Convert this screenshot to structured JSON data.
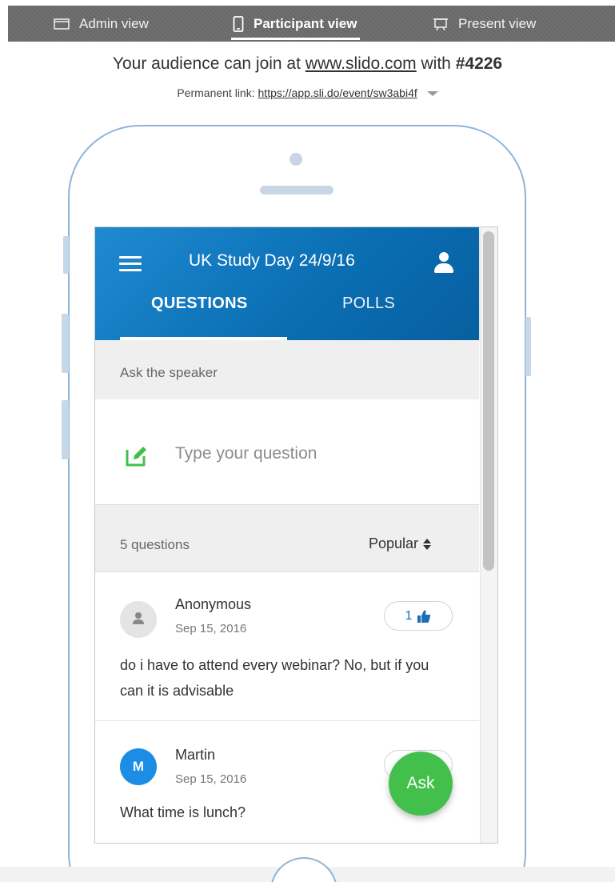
{
  "toolbar": {
    "tabs": [
      {
        "label": "Admin view",
        "icon": "window-icon",
        "active": false
      },
      {
        "label": "Participant view",
        "icon": "mobile-phone-icon",
        "active": true
      },
      {
        "label": "Present view",
        "icon": "projector-screen-icon",
        "active": false
      }
    ]
  },
  "join": {
    "prefix": "Your audience can join at",
    "url": "www.slido.com",
    "middle": "with",
    "code": "#4226",
    "permanent_label": "Permanent link:",
    "permanent_link": "https://app.sli.do/event/sw3abi4f"
  },
  "app": {
    "event_title": "UK Study Day 24/9/16",
    "tabs": [
      {
        "label": "QUESTIONS",
        "active": true
      },
      {
        "label": "POLLS",
        "active": false
      }
    ],
    "ask_label": "Ask the speaker",
    "question_placeholder": "Type your question",
    "question_count": "5 questions",
    "sort_value": "Popular",
    "questions": [
      {
        "author": "Anonymous",
        "avatar": "",
        "date": "Sep 15, 2016",
        "likes": "1",
        "text": "do i have to attend every webinar? No, but if you can it is advisable"
      },
      {
        "author": "Martin",
        "avatar": "M",
        "date": "Sep 15, 2016",
        "likes": "",
        "text": "What time is lunch?"
      }
    ],
    "ask_button": "Ask"
  },
  "colors": {
    "toolbar_bg": "#6b6b6b",
    "header_blue": "#0b6fb4",
    "accent_green": "#43c04b",
    "avatar_blue": "#1b8de4",
    "phone_outline": "#8fb4d6"
  }
}
